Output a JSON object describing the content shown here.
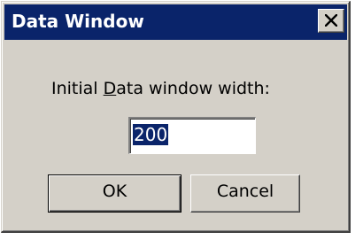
{
  "window": {
    "title": "Data Window",
    "close_icon": "close-x-icon"
  },
  "form": {
    "label_prefix": "Initial ",
    "label_mnemonic": "D",
    "label_suffix": "ata window width:",
    "width_value": "200"
  },
  "buttons": {
    "ok_label": "OK",
    "cancel_label": "Cancel"
  },
  "colors": {
    "titlebar": "#0a246a",
    "face": "#d4d0c8",
    "selection": "#0a246a"
  }
}
